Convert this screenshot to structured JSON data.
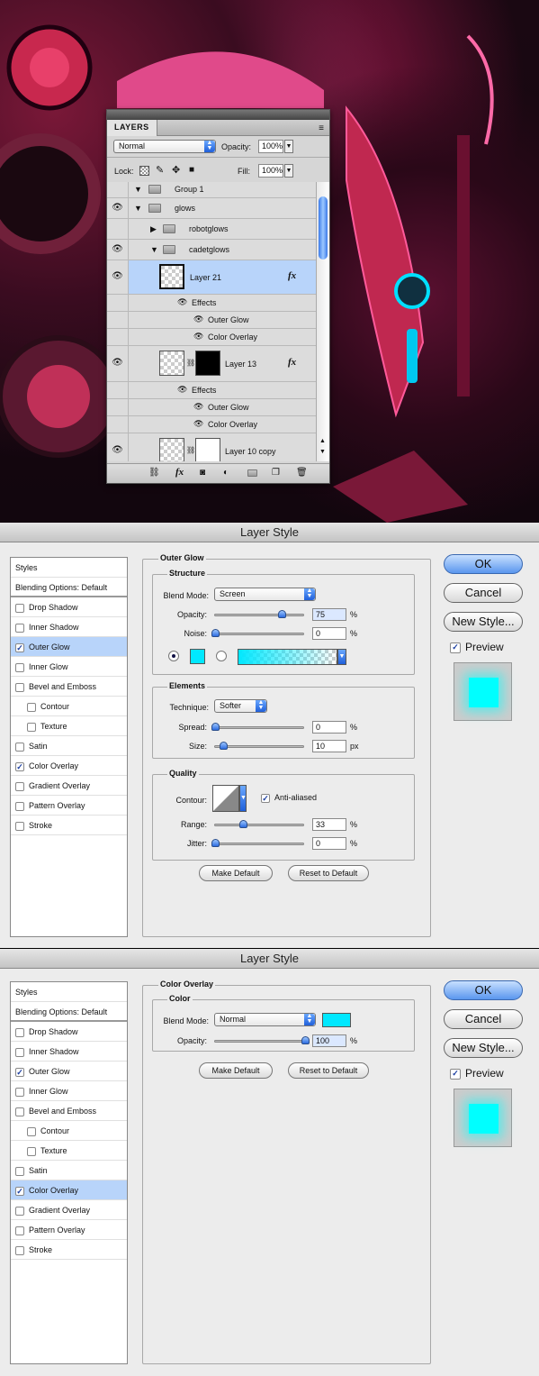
{
  "layers_panel": {
    "tab": "LAYERS",
    "blend_mode": "Normal",
    "opacity_label": "Opacity:",
    "opacity_value": "100%",
    "lock_label": "Lock:",
    "fill_label": "Fill:",
    "fill_value": "100%",
    "rows": {
      "group1": "Group 1",
      "glows": "glows",
      "robotglows": "robotglows",
      "cadetglows": "cadetglows",
      "layer21": "Layer 21",
      "effects_a": "Effects",
      "outer_glow_a": "Outer Glow",
      "color_overlay_a": "Color Overlay",
      "layer13": "Layer 13",
      "effects_b": "Effects",
      "outer_glow_b": "Outer Glow",
      "color_overlay_b": "Color Overlay",
      "layer10copy": "Layer 10 copy"
    },
    "fx": "fx"
  },
  "dialog1": {
    "title": "Layer Style",
    "styles": [
      "Styles",
      "Blending Options: Default",
      "Drop Shadow",
      "Inner Shadow",
      "Outer Glow",
      "Inner Glow",
      "Bevel and Emboss",
      "Contour",
      "Texture",
      "Satin",
      "Color Overlay",
      "Gradient Overlay",
      "Pattern Overlay",
      "Stroke"
    ],
    "section": "Outer Glow",
    "structure": "Structure",
    "blend_mode_label": "Blend Mode:",
    "blend_mode": "Screen",
    "opacity_label": "Opacity:",
    "opacity": "75",
    "noise_label": "Noise:",
    "noise": "0",
    "pct": "%",
    "elements": "Elements",
    "technique_label": "Technique:",
    "technique": "Softer",
    "spread_label": "Spread:",
    "spread": "0",
    "size_label": "Size:",
    "size": "10",
    "px": "px",
    "quality": "Quality",
    "contour_label": "Contour:",
    "anti_aliased": "Anti-aliased",
    "range_label": "Range:",
    "range": "33",
    "jitter_label": "Jitter:",
    "jitter": "0",
    "make_default": "Make Default",
    "reset_default": "Reset to Default",
    "ok": "OK",
    "cancel": "Cancel",
    "new_style": "New Style...",
    "preview": "Preview"
  },
  "dialog2": {
    "title": "Layer Style",
    "styles": [
      "Styles",
      "Blending Options: Default",
      "Drop Shadow",
      "Inner Shadow",
      "Outer Glow",
      "Inner Glow",
      "Bevel and Emboss",
      "Contour",
      "Texture",
      "Satin",
      "Color Overlay",
      "Gradient Overlay",
      "Pattern Overlay",
      "Stroke"
    ],
    "section": "Color Overlay",
    "color": "Color",
    "blend_mode_label": "Blend Mode:",
    "blend_mode": "Normal",
    "opacity_label": "Opacity:",
    "opacity": "100",
    "pct": "%",
    "make_default": "Make Default",
    "reset_default": "Reset to Default",
    "ok": "OK",
    "cancel": "Cancel",
    "new_style": "New Style...",
    "preview": "Preview"
  },
  "colors": {
    "glow": "#00ffff",
    "selection": "#b8d4fa"
  }
}
